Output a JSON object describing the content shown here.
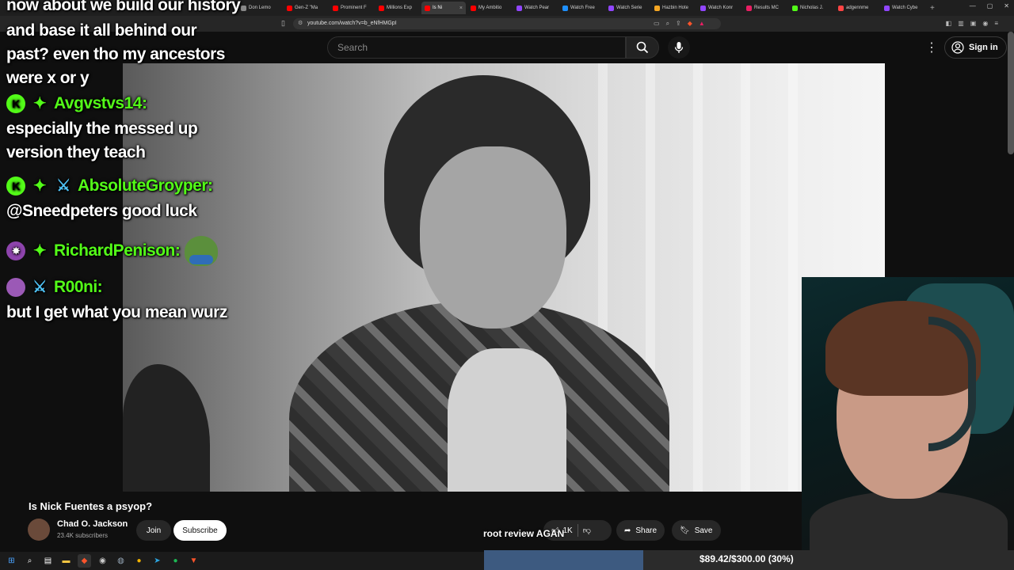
{
  "browser": {
    "tabs": [
      {
        "label": "Don Lemo",
        "color": "#888888"
      },
      {
        "label": "Gen-Z \"Ma",
        "color": "#ff0000"
      },
      {
        "label": "Prominent F",
        "color": "#ff0000"
      },
      {
        "label": "Millions Exp",
        "color": "#ff0000"
      },
      {
        "label": "Is Ni",
        "color": "#ff0000",
        "active": true
      },
      {
        "label": "My Ambitio",
        "color": "#ff0000"
      },
      {
        "label": "Watch Pear",
        "color": "#9146ff"
      },
      {
        "label": "Watch Free",
        "color": "#1e90ff"
      },
      {
        "label": "Watch Serie",
        "color": "#9146ff"
      },
      {
        "label": "Hazbin Hote",
        "color": "#f5a623"
      },
      {
        "label": "Watch Konr",
        "color": "#9146ff"
      },
      {
        "label": "Results MC",
        "color": "#e91e63"
      },
      {
        "label": "Nicholas J.",
        "color": "#53fc18"
      },
      {
        "label": "adgennme",
        "color": "#ff4444"
      },
      {
        "label": "Watch Cybe",
        "color": "#9146ff"
      }
    ],
    "url": "youtube.com/watch?v=b_eNfHMGpI"
  },
  "youtube": {
    "search_placeholder": "Search",
    "signin_label": "Sign in",
    "video_title": "Is Nick Fuentes a psyop?",
    "channel_name": "Chad O. Jackson",
    "subscribers": "23.4K subscribers",
    "join_label": "Join",
    "subscribe_label": "Subscribe",
    "like_count": "1K",
    "share_label": "Share",
    "save_label": "Save"
  },
  "chat": {
    "lines": [
      {
        "text": "now about we build our history"
      },
      {
        "text": "and base it all behind our"
      },
      {
        "text": "past? even tho my ancestors"
      },
      {
        "text": "were x or y"
      },
      {
        "user": "Avgvstvs14:",
        "user_color": "#53fc18",
        "badges": [
          "k",
          "star"
        ]
      },
      {
        "text": "especially the messed up"
      },
      {
        "text": "version they teach"
      },
      {
        "user": "AbsoluteGroyper:",
        "user_color": "#53fc18",
        "badges": [
          "k",
          "star",
          "sword"
        ]
      },
      {
        "text": "@Sneedpeters good luck"
      },
      {
        "user": "RichardPenison:",
        "user_color": "#53fc18",
        "badges": [
          "purple",
          "star"
        ],
        "emote": "pepe"
      },
      {
        "user": "R00ni:",
        "user_color": "#53fc18",
        "badges": [
          "purple2",
          "sword"
        ]
      },
      {
        "text": "but I get what you mean wurz"
      }
    ]
  },
  "stream": {
    "caption": "root review AGAN",
    "goal_text": "$89.42/$300.00 (30%)",
    "goal_fraction": 0.3
  }
}
